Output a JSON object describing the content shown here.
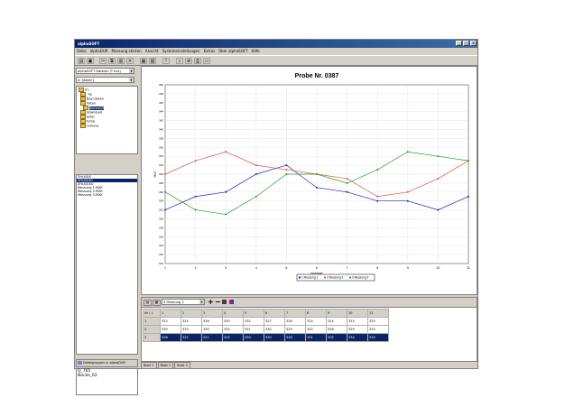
{
  "window": {
    "title": "alphaSOFT"
  },
  "menu": [
    "Datei",
    "alphaDUR",
    "Messung starten",
    "Ansicht",
    "Systemeinstellungen",
    "Extras",
    "Über alphaSOFT",
    "Hilfe"
  ],
  "left": {
    "combo1": "alphaSOFT Dateien (*.hxx)",
    "combo2": "d: [daten]",
    "tree": [
      "d:\\",
      "_hp",
      "Bayr.daten",
      "daten",
      "alphasoft",
      "download",
      "jeder",
      "temp",
      "vsmarp"
    ],
    "list": [
      "ZHLK4IX",
      "ZHLK4IX1",
      "ZHLK4IXO",
      "Messung 1.MXK",
      "Messung 2.MXK",
      "Messung 3.MXK"
    ],
    "group_title": "Dateigruppen in alphaDUR",
    "group_items": [
      "Q_765",
      "Nocke_62"
    ]
  },
  "grid": {
    "select": "3 Messung 2",
    "header": [
      "Nr \\ 1",
      "1",
      "2",
      "3",
      "4",
      "5",
      "6",
      "7",
      "8",
      "9",
      "10",
      "11"
    ],
    "rows": [
      [
        "1",
        "322",
        "325",
        "326",
        "330",
        "332",
        "327",
        "326",
        "324",
        "324",
        "322",
        "325"
      ],
      [
        "2",
        "330",
        "333",
        "335",
        "332",
        "331",
        "330",
        "329",
        "325",
        "326",
        "329",
        "333"
      ],
      [
        "3",
        "326",
        "322",
        "321",
        "325",
        "330",
        "330",
        "328",
        "331",
        "335",
        "334",
        "333"
      ]
    ]
  },
  "tabs": [
    "Blatt 1",
    "Blatt 2",
    "Blatt 3"
  ],
  "chart_data": {
    "type": "line",
    "title": "Probe Nr. 0387",
    "xlabel": "Nummer",
    "ylabel": "HV1",
    "categories": [
      1,
      2,
      3,
      4,
      5,
      6,
      7,
      8,
      9,
      10,
      11
    ],
    "ylim": [
      310,
      350
    ],
    "yticks": [
      310,
      312,
      314,
      316,
      318,
      320,
      322,
      324,
      326,
      328,
      330,
      332,
      334,
      336,
      338,
      340,
      342,
      344,
      346,
      348,
      350
    ],
    "grid": true,
    "legend_position": "bottom",
    "series": [
      {
        "name": "Messung 1",
        "color": "#2020c0",
        "values": [
          322,
          325,
          326,
          330,
          332,
          327,
          326,
          324,
          324,
          322,
          325
        ]
      },
      {
        "name": "Messung 2",
        "color": "#e05050",
        "values": [
          330,
          333,
          335,
          332,
          331,
          330,
          329,
          325,
          326,
          329,
          333
        ]
      },
      {
        "name": "Messung 3",
        "color": "#20a020",
        "values": [
          326,
          322,
          321,
          325,
          330,
          330,
          328,
          331,
          335,
          334,
          333
        ]
      }
    ]
  }
}
